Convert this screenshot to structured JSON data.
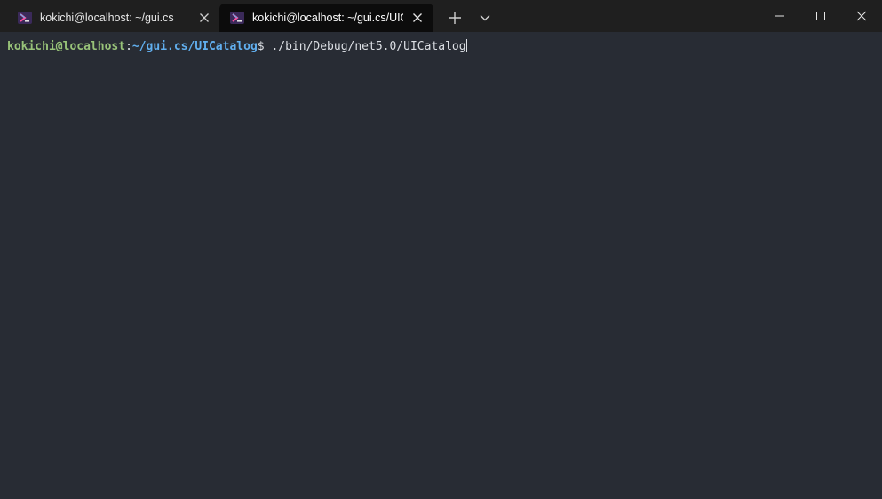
{
  "tabs": [
    {
      "title": "kokichi@localhost: ~/gui.cs",
      "active": false
    },
    {
      "title": "kokichi@localhost: ~/gui.cs/UICatalog",
      "active": true
    }
  ],
  "terminal": {
    "user_host": "kokichi@localhost",
    "colon": ":",
    "path": "~/gui.cs/UICatalog",
    "dollar": "$ ",
    "command": "./bin/Debug/net5.0/UICatalog"
  },
  "colors": {
    "titlebar": "#1f1f1f",
    "active_tab": "#0c0c0c",
    "background": "#282c34",
    "prompt_user": "#98c379",
    "prompt_path": "#61afef",
    "text": "#dcdfe4"
  },
  "icons": {
    "tab_icon": "terminal-app-icon",
    "tab_close": "close-icon",
    "new_tab": "plus-icon",
    "dropdown": "chevron-down-icon",
    "minimize": "minimize-icon",
    "maximize": "maximize-icon",
    "close_window": "close-icon"
  }
}
